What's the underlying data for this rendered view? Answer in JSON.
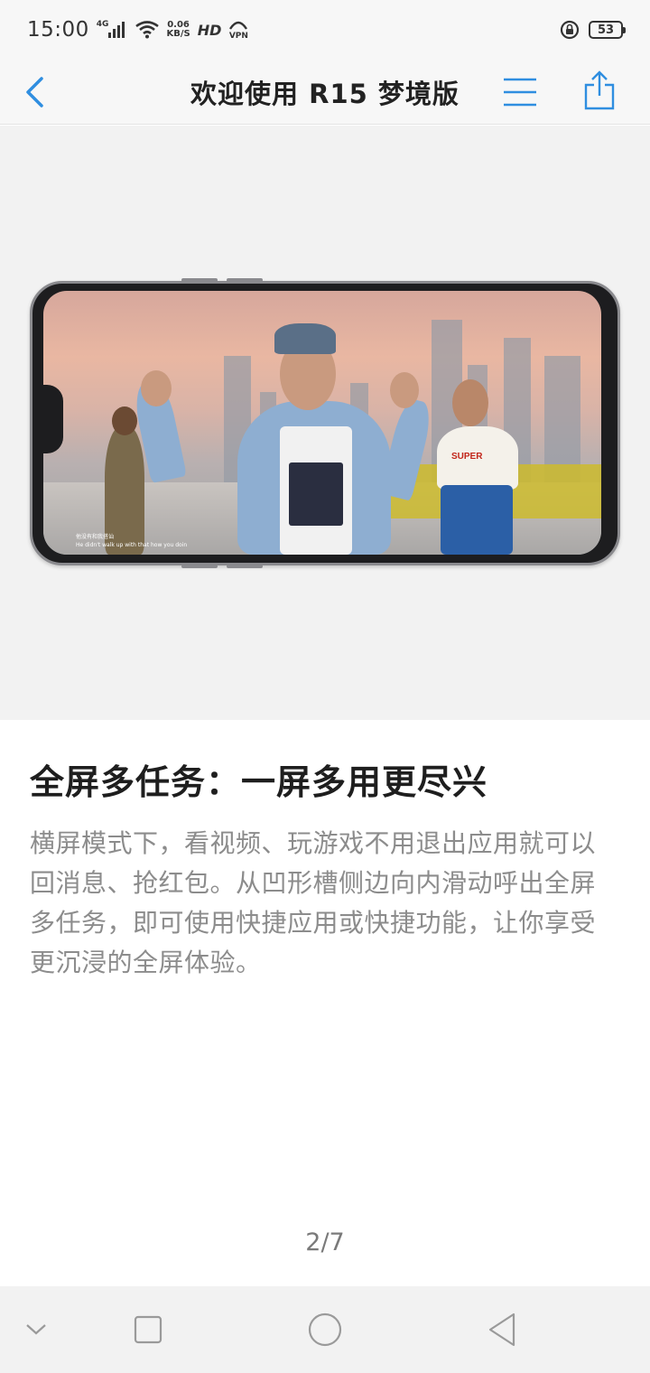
{
  "status": {
    "time": "15:00",
    "signal_label": "4G",
    "net_speed_top": "0.06",
    "net_speed_bottom": "KB/S",
    "hd_label": "HD",
    "vpn_label": "VPN",
    "battery": "53"
  },
  "nav": {
    "title": "欢迎使用 R15 梦境版",
    "back_icon": "chevron-left-icon",
    "menu_icon": "menu-icon",
    "share_icon": "share-icon",
    "accent_color": "#2f8ee0"
  },
  "hero": {
    "caption_cn": "他没有和我搭讪",
    "caption_en": "He didn't walk up with that how you doin",
    "shirt_text": "SUPER"
  },
  "feature": {
    "title": "全屏多任务：一屏多用更尽兴",
    "description": "横屏模式下，看视频、玩游戏不用退出应用就可以回消息、抢红包。从凹形槽侧边向内滑动呼出全屏多任务，即可使用快捷应用或快捷功能，让你享受更沉浸的全屏体验。"
  },
  "pager": {
    "indicator": "2/7"
  },
  "system_nav": {
    "collapse_icon": "chevron-down-icon",
    "recent_icon": "square-icon",
    "home_icon": "circle-icon",
    "back_icon": "triangle-back-icon"
  }
}
